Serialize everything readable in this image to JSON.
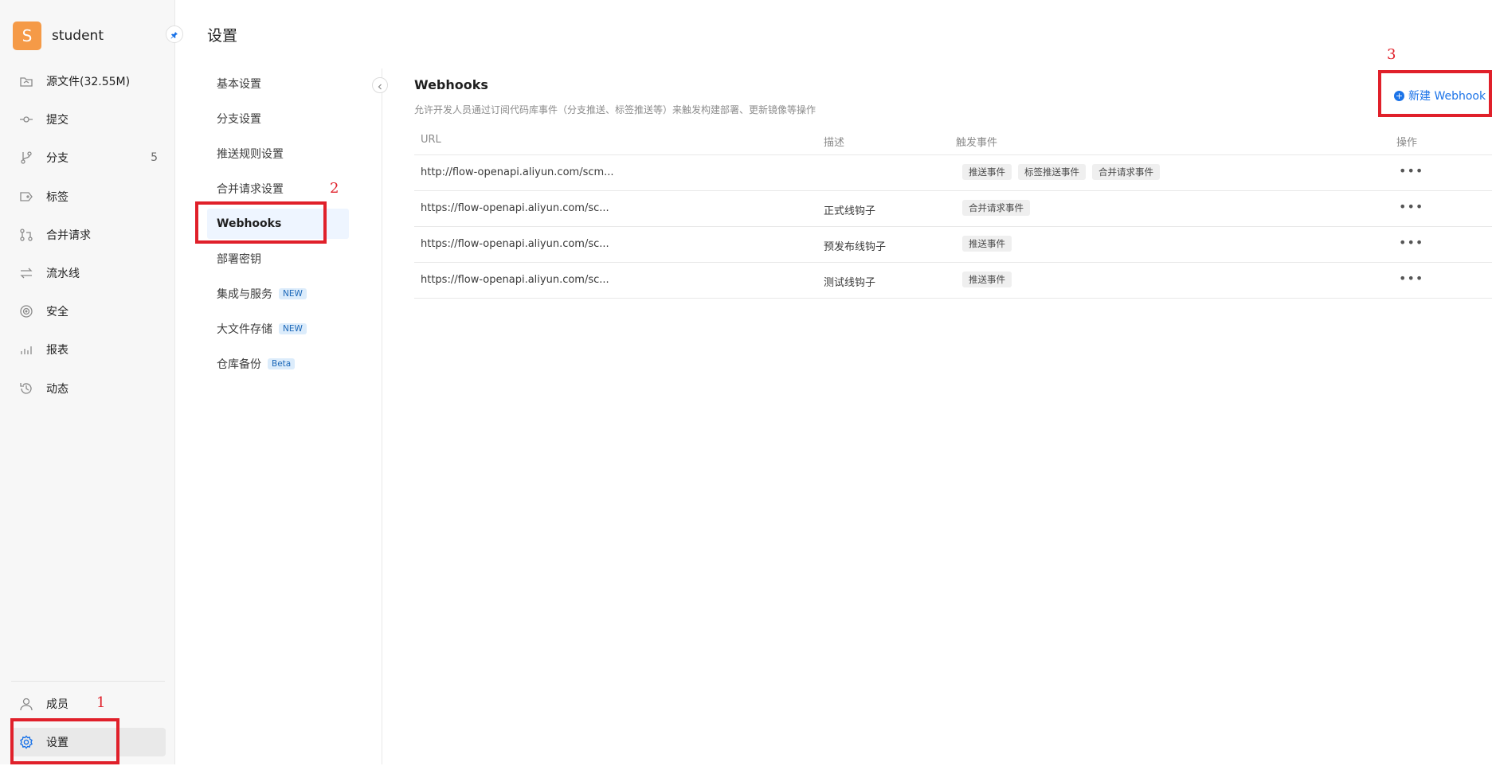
{
  "repo": {
    "avatar_letter": "S",
    "name": "student"
  },
  "sidebar": {
    "items": [
      {
        "label": "源文件(32.55M)",
        "icon": "source-files-icon"
      },
      {
        "label": "提交",
        "icon": "commit-icon"
      },
      {
        "label": "分支",
        "icon": "branch-icon",
        "count": "5"
      },
      {
        "label": "标签",
        "icon": "tag-icon"
      },
      {
        "label": "合并请求",
        "icon": "merge-request-icon"
      },
      {
        "label": "流水线",
        "icon": "pipeline-icon"
      },
      {
        "label": "安全",
        "icon": "security-icon"
      },
      {
        "label": "报表",
        "icon": "report-icon"
      },
      {
        "label": "动态",
        "icon": "history-icon"
      }
    ],
    "bottom_items": [
      {
        "label": "成员",
        "icon": "member-icon"
      },
      {
        "label": "设置",
        "icon": "gear-icon",
        "active": true
      }
    ]
  },
  "page": {
    "title": "设置"
  },
  "submenu": {
    "items": [
      {
        "label": "基本设置"
      },
      {
        "label": "分支设置"
      },
      {
        "label": "推送规则设置"
      },
      {
        "label": "合并请求设置"
      },
      {
        "label": "Webhooks",
        "active": true
      },
      {
        "label": "部署密钥"
      },
      {
        "label": "集成与服务",
        "badge": "NEW"
      },
      {
        "label": "大文件存储",
        "badge": "NEW"
      },
      {
        "label": "仓库备份",
        "badge": "Beta"
      }
    ]
  },
  "main": {
    "title": "Webhooks",
    "description": "允许开发人员通过订阅代码库事件（分支推送、标签推送等）来触发构建部署、更新镜像等操作",
    "new_button_label": "新建 Webhook",
    "columns": {
      "url": "URL",
      "desc": "描述",
      "events": "触发事件",
      "ops": "操作"
    },
    "rows": [
      {
        "url": "http://flow-openapi.aliyun.com/scm...",
        "desc": "",
        "events": [
          "推送事件",
          "标签推送事件",
          "合并请求事件"
        ],
        "ops": "•••"
      },
      {
        "url": "https://flow-openapi.aliyun.com/sc...",
        "desc": "正式线钩子",
        "events": [
          "合并请求事件"
        ],
        "ops": "•••"
      },
      {
        "url": "https://flow-openapi.aliyun.com/sc...",
        "desc": "预发布线钩子",
        "events": [
          "推送事件"
        ],
        "ops": "•••"
      },
      {
        "url": "https://flow-openapi.aliyun.com/sc...",
        "desc": "测试线钩子",
        "events": [
          "推送事件"
        ],
        "ops": "•••"
      }
    ]
  },
  "annotations": [
    "1",
    "2",
    "3"
  ],
  "colors": {
    "accent": "#1b73e8",
    "annotation_red": "#e0202a",
    "avatar": "#f59a47"
  }
}
